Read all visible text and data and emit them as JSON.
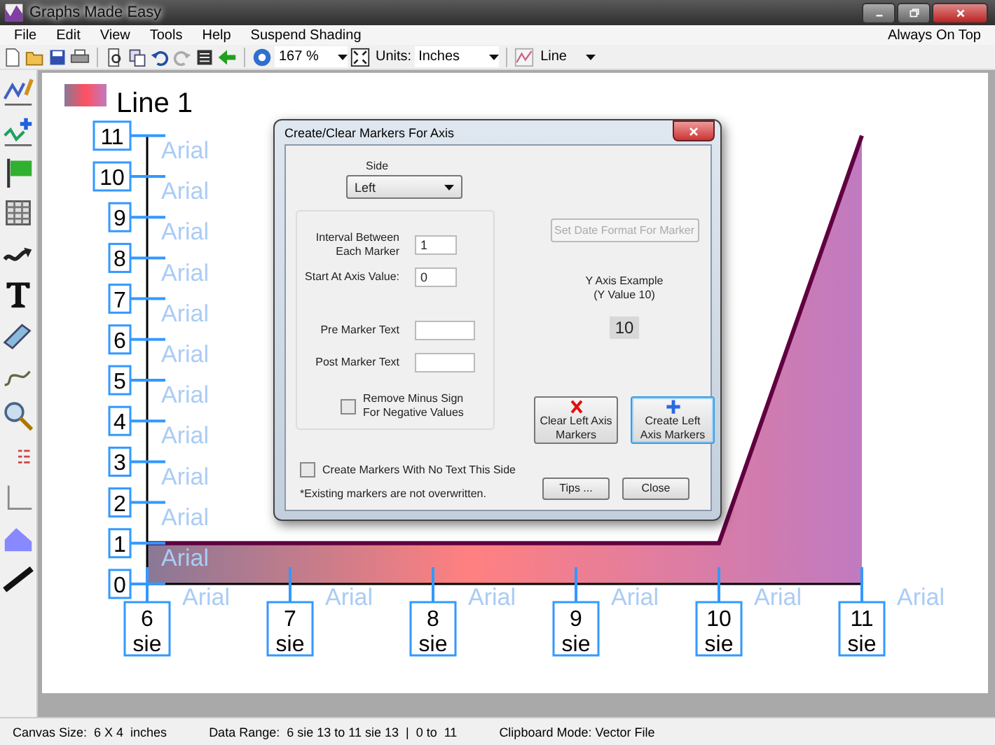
{
  "window": {
    "title": "Graphs Made Easy"
  },
  "menu": {
    "items": [
      "File",
      "Edit",
      "View",
      "Tools",
      "Help",
      "Suspend Shading"
    ],
    "right": "Always On Top"
  },
  "toolbar": {
    "zoom": "167 %",
    "units_label": "Units:",
    "units": "Inches",
    "chart_type": "Line"
  },
  "canvas": {
    "chart_data": {
      "type": "area",
      "categories": [
        "6",
        "7",
        "8",
        "9",
        "10",
        "11"
      ],
      "yticks": [
        0,
        1,
        2,
        3,
        4,
        5,
        6,
        7,
        8,
        9,
        10,
        11
      ],
      "ylim": [
        0,
        11
      ],
      "series": [
        {
          "name": "Line 1",
          "color": "#600040",
          "values": [
            1,
            null,
            null,
            null,
            1,
            11
          ]
        }
      ]
    },
    "x_marker_units": [
      "sie",
      "sie",
      "sie",
      "sie",
      "sie",
      "sie"
    ],
    "y_marker_hints": [
      "Arial",
      "Arial",
      "Arial",
      "Arial",
      "Arial",
      "Arial",
      "Arial",
      "Arial",
      "Arial",
      "Arial",
      "Arial"
    ],
    "x_marker_hints": [
      "Arial",
      "Arial",
      "Arial",
      "Arial",
      "Arial",
      "Arial"
    ]
  },
  "dialog": {
    "title": "Create/Clear Markers For Axis",
    "side_label": "Side",
    "side": "Left",
    "fields": [
      {
        "label_lines": [
          "Interval Between",
          "Each Marker"
        ],
        "value": "1"
      },
      {
        "label_lines": [
          "Start At Axis Value:"
        ],
        "value": "0"
      },
      {
        "label_lines": [
          "Pre Marker Text"
        ]
      },
      {
        "label_lines": [
          "Post Marker Text"
        ]
      }
    ],
    "remove_minus": {
      "label_lines": [
        "Remove Minus Sign",
        "For Negative Values"
      ],
      "checked": false
    },
    "date_button": {
      "label": "Set Date Format For Marker",
      "disabled": true
    },
    "example_caption": [
      "Y Axis Example",
      "(Y Value 10)"
    ],
    "example_value": "10",
    "clear_button": {
      "label_lines": [
        "Clear Left Axis",
        "Markers"
      ],
      "focused": false
    },
    "create_button": {
      "label_lines": [
        "Create Left",
        "Axis Markers"
      ],
      "focused": true
    },
    "no_text": {
      "label": "Create Markers With No Text This Side",
      "checked": false
    },
    "note": "*Existing markers are not overwritten.",
    "buttons": [
      "Tips ...",
      "Close"
    ]
  },
  "status_bar": [
    "Canvas Size:  6 X 4  inches",
    "Data Range:  6 sie 13 to 11 sie 13  |  0 to  11",
    "Clipboard Mode: Vector File"
  ]
}
